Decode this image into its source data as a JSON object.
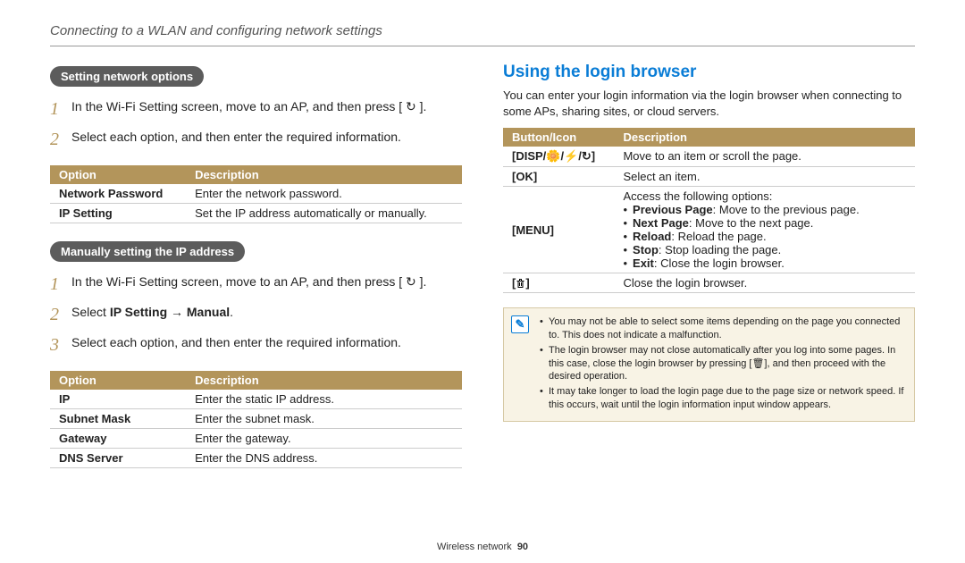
{
  "header": "Connecting to a WLAN and configuring network settings",
  "left": {
    "pill1": "Setting network options",
    "steps1": [
      "In the Wi-Fi Setting screen, move to an AP, and then press [ ↻ ].",
      "Select each option, and then enter the required information."
    ],
    "table1": {
      "headers": [
        "Option",
        "Description"
      ],
      "rows": [
        [
          "Network Password",
          "Enter the network password."
        ],
        [
          "IP Setting",
          "Set the IP address automatically or manually."
        ]
      ]
    },
    "pill2": "Manually setting the IP address",
    "steps2_1": "In the Wi-Fi Setting screen, move to an AP, and then press [ ↻ ].",
    "steps2_2_prefix": "Select ",
    "steps2_2_bold": "IP Setting → Manual",
    "steps2_2_suffix": ".",
    "steps2_3": "Select each option, and then enter the required information.",
    "table2": {
      "headers": [
        "Option",
        "Description"
      ],
      "rows": [
        [
          "IP",
          "Enter the static IP address."
        ],
        [
          "Subnet Mask",
          "Enter the subnet mask."
        ],
        [
          "Gateway",
          "Enter the gateway."
        ],
        [
          "DNS Server",
          "Enter the DNS address."
        ]
      ]
    }
  },
  "right": {
    "title": "Using the login browser",
    "intro": "You can enter your login information via the login browser when connecting to some APs, sharing sites, or cloud servers.",
    "table_headers": [
      "Button/Icon",
      "Description"
    ],
    "row1_btn": "[DISP/🌼/⚡/↻]",
    "row1_desc": "Move to an item or scroll the page.",
    "row2_btn": "[OK]",
    "row2_desc": "Select an item.",
    "row3_btn": "[MENU]",
    "row3_intro": "Access the following options:",
    "row3_items": [
      {
        "b": "Previous Page",
        "t": ": Move to the previous page."
      },
      {
        "b": "Next Page",
        "t": ": Move to the next page."
      },
      {
        "b": "Reload",
        "t": ": Reload the page."
      },
      {
        "b": "Stop",
        "t": ": Stop loading the page."
      },
      {
        "b": "Exit",
        "t": ": Close the login browser."
      }
    ],
    "row4_desc": "Close the login browser.",
    "note_items": [
      "You may not be able to select some items depending on the page you connected to. This does not indicate a malfunction.",
      "The login browser may not close automatically after you log into some pages. In this case, close the login browser by pressing [🗑], and then proceed with the desired operation.",
      "It may take longer to load the login page due to the page size or network speed. If this occurs, wait until the login information input window appears."
    ]
  },
  "footer_section": "Wireless network",
  "footer_page": "90"
}
